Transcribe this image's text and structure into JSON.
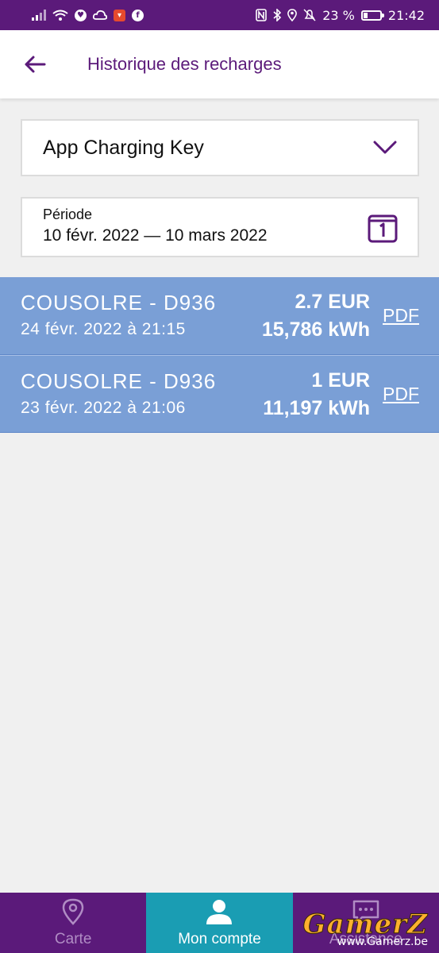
{
  "status_bar": {
    "battery": "23 %",
    "time": "21:42"
  },
  "header": {
    "title": "Historique des recharges"
  },
  "selector": {
    "value": "App Charging Key"
  },
  "period": {
    "label": "Période",
    "value": "10 févr. 2022 — 10 mars 2022"
  },
  "charges": [
    {
      "location": "COUSOLRE - D936",
      "date": "24 févr. 2022 à 21:15",
      "amount": "2.7 EUR",
      "energy": "15,786 kWh",
      "pdf": "PDF"
    },
    {
      "location": "COUSOLRE - D936",
      "date": "23 févr. 2022 à 21:06",
      "amount": "1 EUR",
      "energy": "11,197 kWh",
      "pdf": "PDF"
    }
  ],
  "nav": {
    "items": [
      {
        "label": "Carte",
        "icon": "map-pin-icon"
      },
      {
        "label": "Mon compte",
        "icon": "user-icon"
      },
      {
        "label": "Assistance",
        "icon": "chat-icon"
      }
    ]
  },
  "watermark": {
    "brand": "GamerZ",
    "site": "www.Gamerz.be"
  },
  "colors": {
    "brand_purple": "#5b1a7a",
    "row_blue": "#7a9fd6",
    "nav_active": "#1a9db3",
    "background": "#f0f0f0"
  }
}
